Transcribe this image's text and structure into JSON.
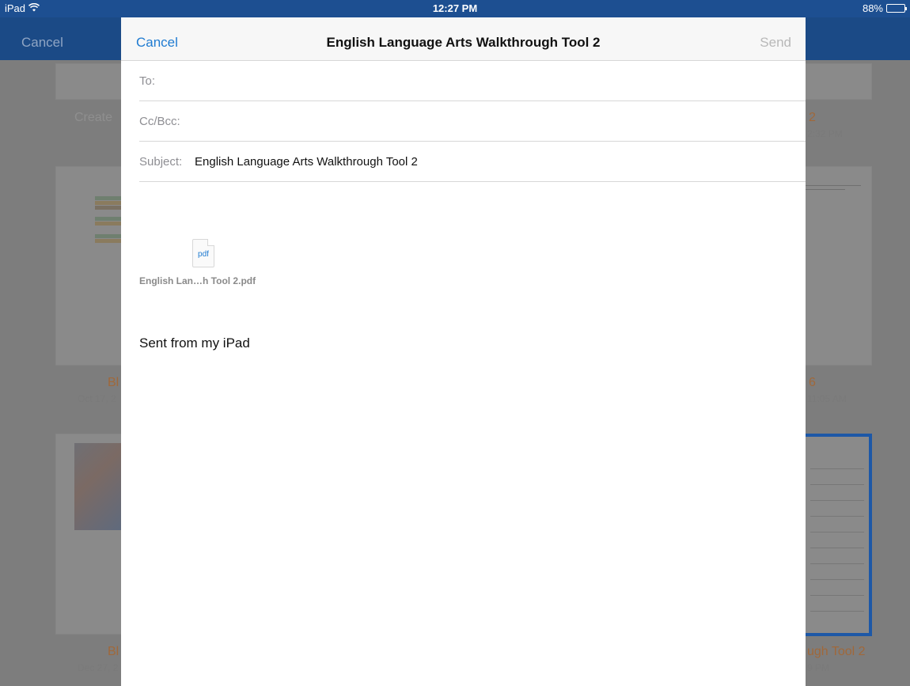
{
  "status_bar": {
    "device": "iPad",
    "wifi_icon": "wifi-icon",
    "time": "12:27 PM",
    "battery_text": "88%",
    "battery_level": 0.88
  },
  "background": {
    "nav_cancel": "Cancel",
    "cards": [
      {
        "title": "Create",
        "date": ""
      },
      {
        "title": "2",
        "date": "2:32 PM"
      },
      {
        "title": "Bl",
        "date": "Oct 17, 2"
      },
      {
        "title": "6",
        "date": "11:05 AM"
      },
      {
        "title": "Bl",
        "date": "Dec 27, 2"
      },
      {
        "title": "ugh Tool 2",
        "date": "9 PM"
      }
    ]
  },
  "compose": {
    "cancel_label": "Cancel",
    "title": "English Language Arts Walkthrough Tool 2",
    "send_label": "Send",
    "to_label": "To:",
    "to_value": "",
    "cc_label": "Cc/Bcc:",
    "cc_value": "",
    "subject_label": "Subject:",
    "subject_value": "English Language Arts Walkthrough Tool 2",
    "attachment": {
      "icon_text": "pdf",
      "name": "English Lan…h Tool 2.pdf"
    },
    "signature": "Sent from my iPad"
  }
}
